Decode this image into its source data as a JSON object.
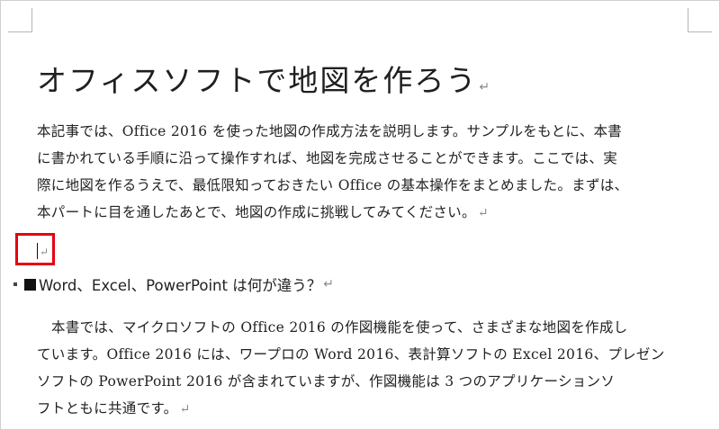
{
  "document": {
    "title": "オフィスソフトで地図を作ろう",
    "paragraph_mark": "↵",
    "intro_lines": [
      "本記事では、Office 2016 を使った地図の作成方法を説明します。サンプルをもとに、本書",
      "に書かれている手順に沿って操作すれば、地図を完成させることができます。ここでは、実",
      "際に地図を作るうえで、最低限知っておきたい Office の基本操作をまとめました。まずは、",
      "本パートに目を通したあとで、地図の作成に挑戦してみてください。"
    ],
    "heading": "Word、Excel、PowerPoint は何が違う？",
    "body_lines": [
      "本書では、マイクロソフトの Office 2016 の作図機能を使って、さまざまな地図を作成し",
      "ています。Office 2016 には、ワープロの Word 2016、表計算ソフトの Excel 2016、プレゼン",
      "ソフトの PowerPoint 2016 が含まれていますが、作図機能は 3 つのアプリケーションソ",
      "フトともに共通です。"
    ]
  },
  "colors": {
    "highlight_box": "#e60012",
    "text": "#222222",
    "formatting_mark": "#8a8a8a"
  }
}
